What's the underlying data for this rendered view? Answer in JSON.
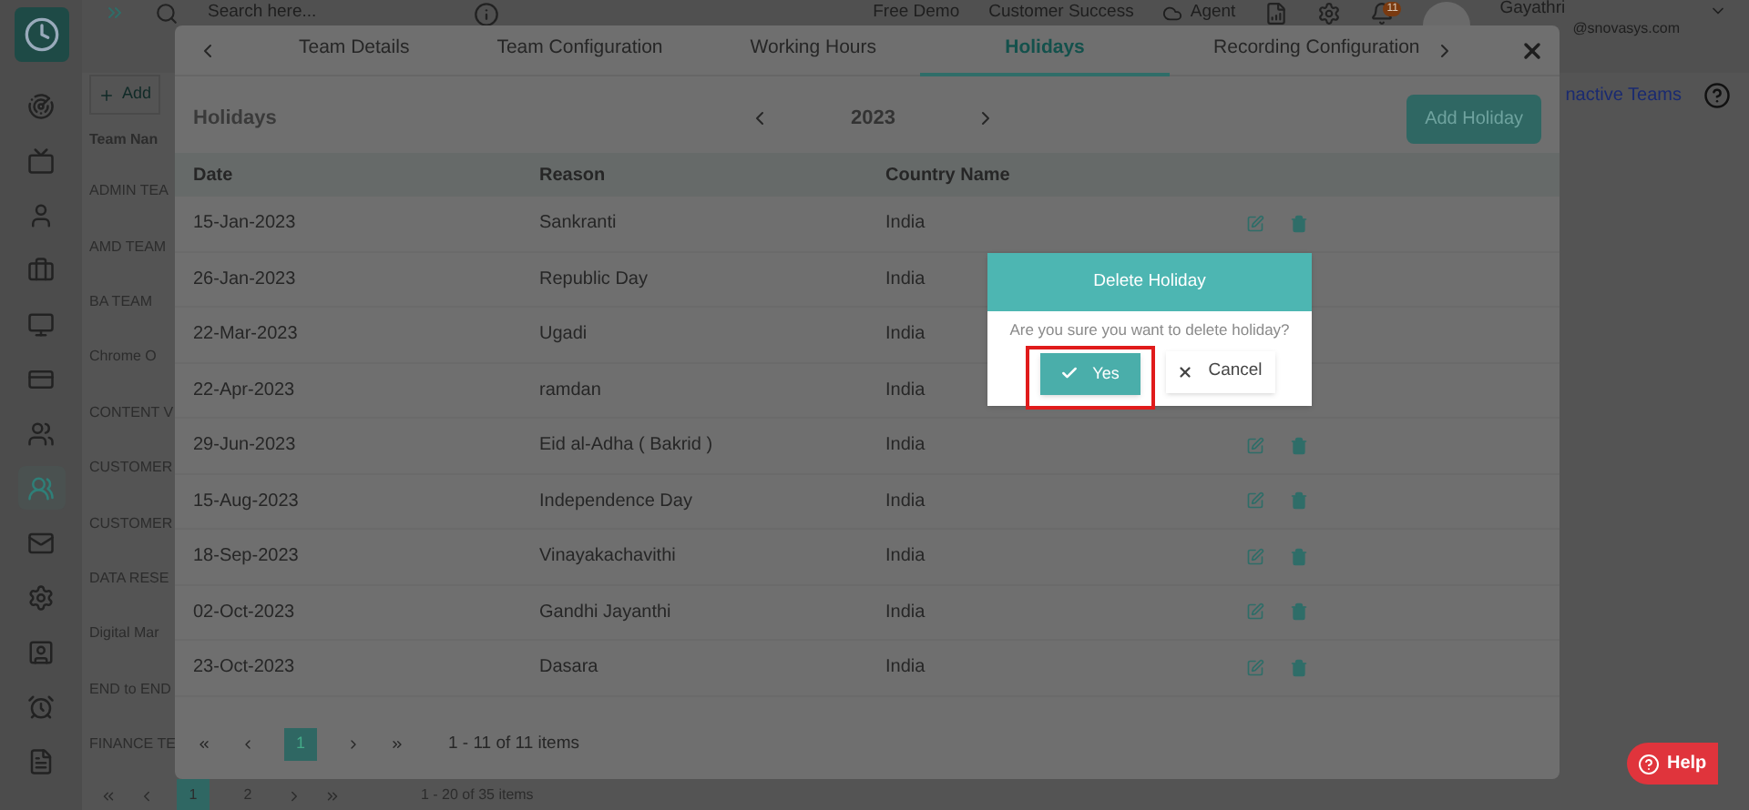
{
  "topbar": {
    "search_placeholder": "Search here...",
    "links": [
      "Free Demo",
      "Customer Success",
      "Agent"
    ],
    "notification_count": "11",
    "user_name": "Gayathri",
    "user_email": "@snovasys.com"
  },
  "sidebar": {
    "items": [
      {
        "selected": false
      },
      {
        "selected": false
      },
      {
        "selected": false
      },
      {
        "selected": false
      },
      {
        "selected": false
      },
      {
        "selected": false
      },
      {
        "selected": false
      },
      {
        "selected": true
      },
      {
        "selected": false
      },
      {
        "selected": false
      },
      {
        "selected": false
      },
      {
        "selected": false
      },
      {
        "selected": false
      }
    ]
  },
  "teams": {
    "add_label": "Add",
    "column": "Team Nan",
    "inactive_link": "nactive Teams",
    "rows": [
      "ADMIN TEA",
      "AMD TEAM",
      "BA TEAM",
      "Chrome O",
      "CONTENT V",
      "CUSTOMER",
      "CUSTOMER",
      "DATA RESE",
      "Digital Mar",
      "END to END",
      "FINANCE TE"
    ],
    "pager": {
      "pages": [
        {
          "label": "1",
          "selected": true
        },
        {
          "label": "2",
          "selected": false
        }
      ],
      "summary": "1 - 20 of 35 items"
    }
  },
  "modal": {
    "tabs": [
      {
        "label": "Team Details",
        "selected": false
      },
      {
        "label": "Team Configuration",
        "selected": false
      },
      {
        "label": "Working Hours",
        "selected": false
      },
      {
        "label": "Holidays",
        "selected": true
      },
      {
        "label": "Recording Configuration",
        "selected": false
      }
    ],
    "heading": "Holidays",
    "year": "2023",
    "add_button": "Add Holiday",
    "table": {
      "columns": [
        "Date",
        "Reason",
        "Country Name"
      ],
      "rows": [
        {
          "date": "15-Jan-2023",
          "reason": "Sankranti",
          "country": "India"
        },
        {
          "date": "26-Jan-2023",
          "reason": "Republic Day",
          "country": "India"
        },
        {
          "date": "22-Mar-2023",
          "reason": "Ugadi",
          "country": "India"
        },
        {
          "date": "22-Apr-2023",
          "reason": "ramdan",
          "country": "India"
        },
        {
          "date": "29-Jun-2023",
          "reason": "Eid al-Adha ( Bakrid )",
          "country": "India"
        },
        {
          "date": "15-Aug-2023",
          "reason": "Independence Day",
          "country": "India"
        },
        {
          "date": "18-Sep-2023",
          "reason": "Vinayakachavithi",
          "country": "India"
        },
        {
          "date": "02-Oct-2023",
          "reason": "Gandhi Jayanthi",
          "country": "India"
        },
        {
          "date": "23-Oct-2023",
          "reason": "Dasara",
          "country": "India"
        }
      ]
    },
    "pager": {
      "pages": [
        {
          "label": "1",
          "selected": true
        }
      ],
      "summary": "1 - 11 of 11 items"
    }
  },
  "confirm": {
    "title": "Delete Holiday",
    "message": "Are you sure you want to delete holiday?",
    "buttons": [
      {
        "kind": "confirm",
        "label": "Yes",
        "highlighted": true
      },
      {
        "kind": "cancel",
        "label": "Cancel",
        "highlighted": false
      }
    ]
  },
  "help_button": "Help"
}
